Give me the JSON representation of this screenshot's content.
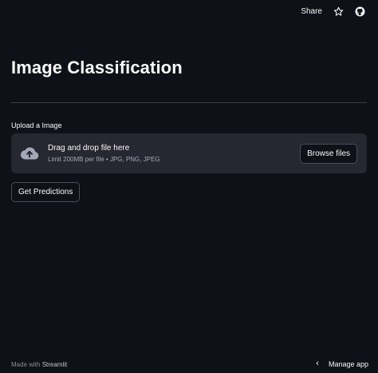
{
  "header": {
    "share_label": "Share",
    "icons": [
      "star-icon",
      "github-icon"
    ]
  },
  "main": {
    "title": "Image Classification",
    "upload": {
      "label": "Upload a Image",
      "drop_title": "Drag and drop file here",
      "drop_subtitle": "Limit 200MB per file • JPG, PNG, JPEG",
      "browse_label": "Browse files"
    },
    "predict_label": "Get Predictions"
  },
  "footer": {
    "made_with": "Made with",
    "brand": "Streamlit",
    "manage_label": "Manage app"
  },
  "colors": {
    "background": "#0e1117",
    "dropzone": "#262730",
    "text": "#fafafa"
  }
}
